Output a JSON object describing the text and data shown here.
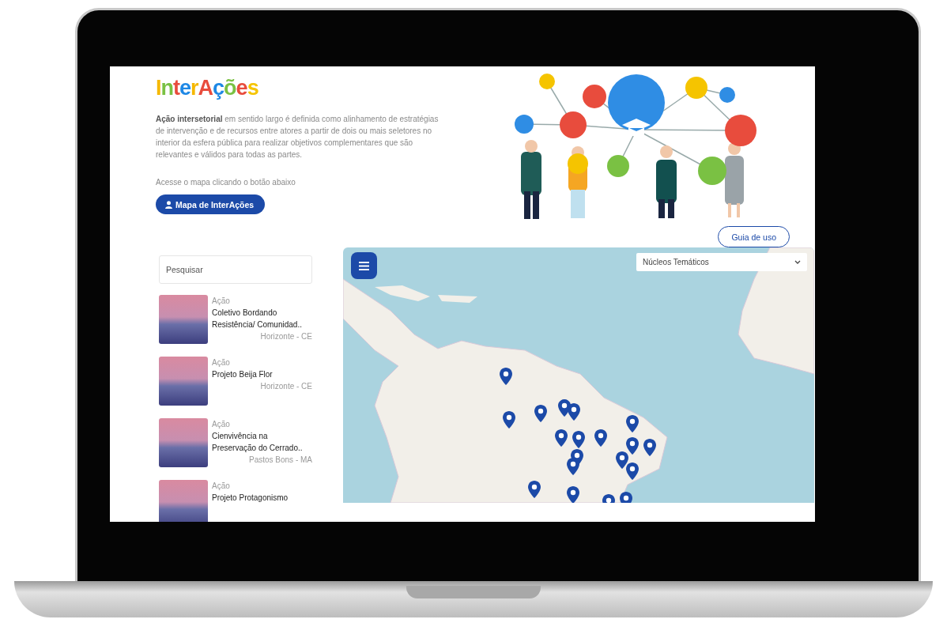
{
  "logo": "InterAções",
  "intro": {
    "text": "**Ação intersetorial** em sentido largo é definida como alinhamento de estratégias de intervenção e de recursos entre atores a partir de dois ou mais seletores no interior da esfera pública para realizar objetivos complementares que são relevantes e válidos para todas as partes.",
    "hint": "Acesse o mapa clicando o botão abaixo",
    "button": "Mapa de InterAções"
  },
  "guide_button": "Guia de uso",
  "search": {
    "placeholder": "Pesquisar"
  },
  "actions": [
    {
      "type": "Ação",
      "title": "Coletivo Bordando Resistência/ Comunidad..",
      "place": "Horizonte - CE"
    },
    {
      "type": "Ação",
      "title": "Projeto Beija Flor",
      "place": "Horizonte - CE"
    },
    {
      "type": "Ação",
      "title": "Cienvivência na Preservação do Cerrado..",
      "place": "Pastos Bons - MA"
    },
    {
      "type": "Ação",
      "title": "Projeto Protagonismo"
    }
  ],
  "map": {
    "filter": "Núcleos Temáticos"
  }
}
